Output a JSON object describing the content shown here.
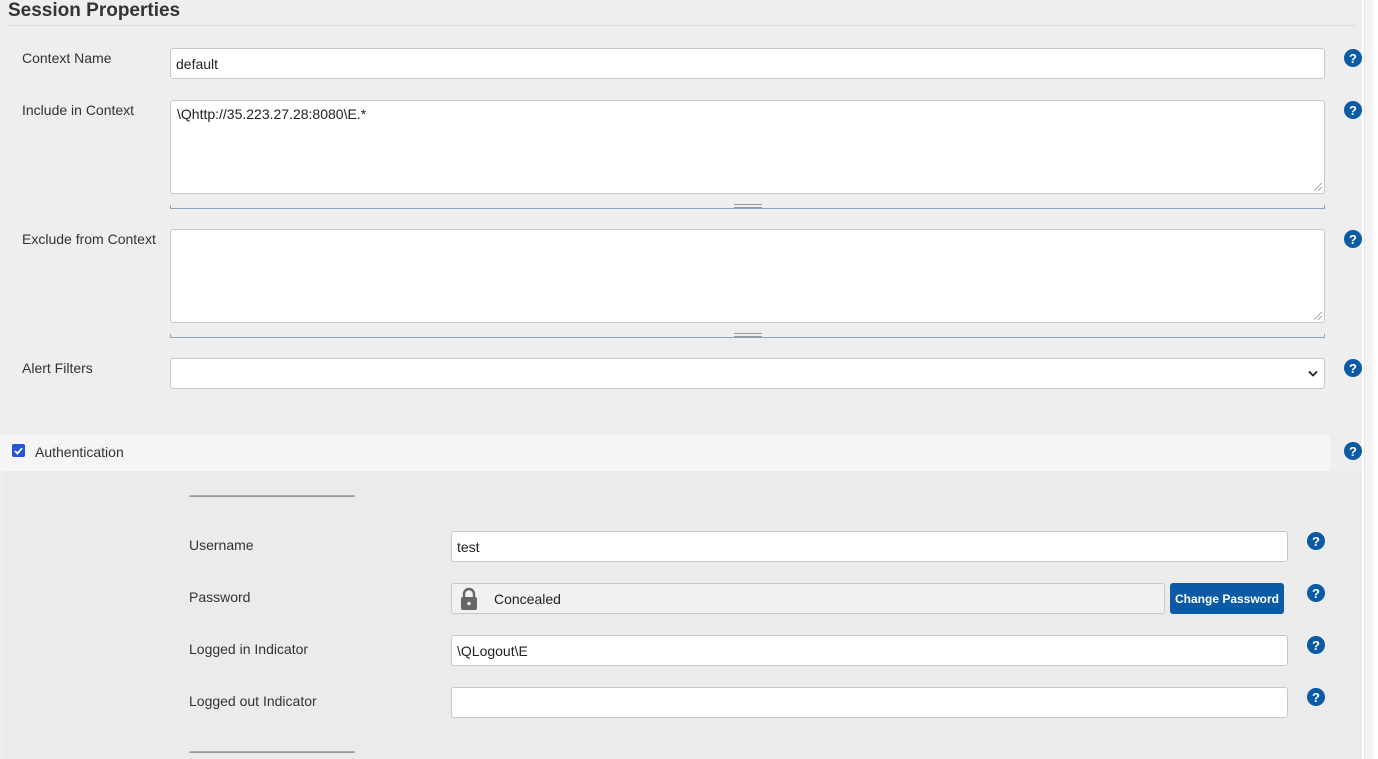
{
  "page": {
    "title": "Session Properties"
  },
  "help": {
    "symbol": "?"
  },
  "context": {
    "name_label": "Context Name",
    "name_value": "default",
    "include_label": "Include in Context",
    "include_value": "\\Qhttp://35.223.27.28:8080\\E.*",
    "exclude_label": "Exclude from Context",
    "exclude_value": "",
    "alert_filters_label": "Alert Filters",
    "alert_filters_value": ""
  },
  "authentication": {
    "checkbox_label": "Authentication",
    "checked": true,
    "separator": "--------------------------------------------------------------",
    "username_label": "Username",
    "username_value": "test",
    "password_label": "Password",
    "password_value": "Concealed",
    "change_password_label": "Change Password",
    "logged_in_label": "Logged in Indicator",
    "logged_in_value": "\\QLogout\\E",
    "logged_out_label": "Logged out Indicator",
    "logged_out_value": ""
  },
  "colors": {
    "accent": "#0b5aa6",
    "checkbox": "#2457d6"
  }
}
